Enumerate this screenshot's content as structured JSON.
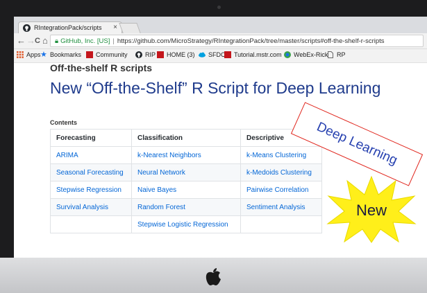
{
  "browser": {
    "tab_title": "RIntegrationPack/scripts",
    "tab_close": "×",
    "nav_back": "←",
    "nav_forward": "→",
    "nav_reload": "C",
    "nav_home": "⌂",
    "secure_label": "GitHub, Inc. [US]",
    "url_separator": "|",
    "url": "https://github.com/MicroStrategy/RIntegrationPack/tree/master/scripts#off-the-shelf-r-scripts"
  },
  "bookmarks": [
    {
      "label": "Apps",
      "icon": "apps-grid-icon",
      "color": "#e05a2b"
    },
    {
      "label": "Bookmarks",
      "icon": "star-icon",
      "color": "#1a73e8"
    },
    {
      "label": "Community",
      "icon": "microstrategy-icon",
      "color": "#c4161c"
    },
    {
      "label": "RIP",
      "icon": "github-icon",
      "color": "#24292e"
    },
    {
      "label": "HOME (3)",
      "icon": "microstrategy-icon",
      "color": "#c4161c"
    },
    {
      "label": "SFDC",
      "icon": "cloud-icon",
      "color": "#00a1e0"
    },
    {
      "label": "Tutorial.mstr.com",
      "icon": "microstrategy-icon",
      "color": "#c4161c"
    },
    {
      "label": "WebEx-Rick",
      "icon": "webex-icon",
      "color": "#3aa34a"
    },
    {
      "label": "RP",
      "icon": "document-icon",
      "color": "#666666"
    }
  ],
  "page": {
    "heading": "Off-the-shelf R scripts",
    "overlay_title": "New “Off-the-Shelf” R Script for Deep Learning",
    "contents_label": "Contents",
    "table": {
      "headers": [
        "Forecasting",
        "Classification",
        "Descriptive"
      ],
      "rows": [
        [
          "ARIMA",
          "k-Nearest Neighbors",
          "k-Means Clustering"
        ],
        [
          "Seasonal Forecasting",
          "Neural Network",
          "k-Medoids Clustering"
        ],
        [
          "Stepwise Regression",
          "Naive Bayes",
          "Pairwise Correlation"
        ],
        [
          "Survival Analysis",
          "Random Forest",
          "Sentiment Analysis"
        ],
        [
          "",
          "Stepwise Logistic Regression",
          ""
        ]
      ]
    }
  },
  "callouts": {
    "deep_learning": "Deep Learning",
    "new": "New"
  },
  "colors": {
    "title_blue": "#1f3b8c",
    "link_blue": "#0366d6",
    "burst_yellow": "#ffef1a",
    "callout_red": "#e0241b"
  }
}
